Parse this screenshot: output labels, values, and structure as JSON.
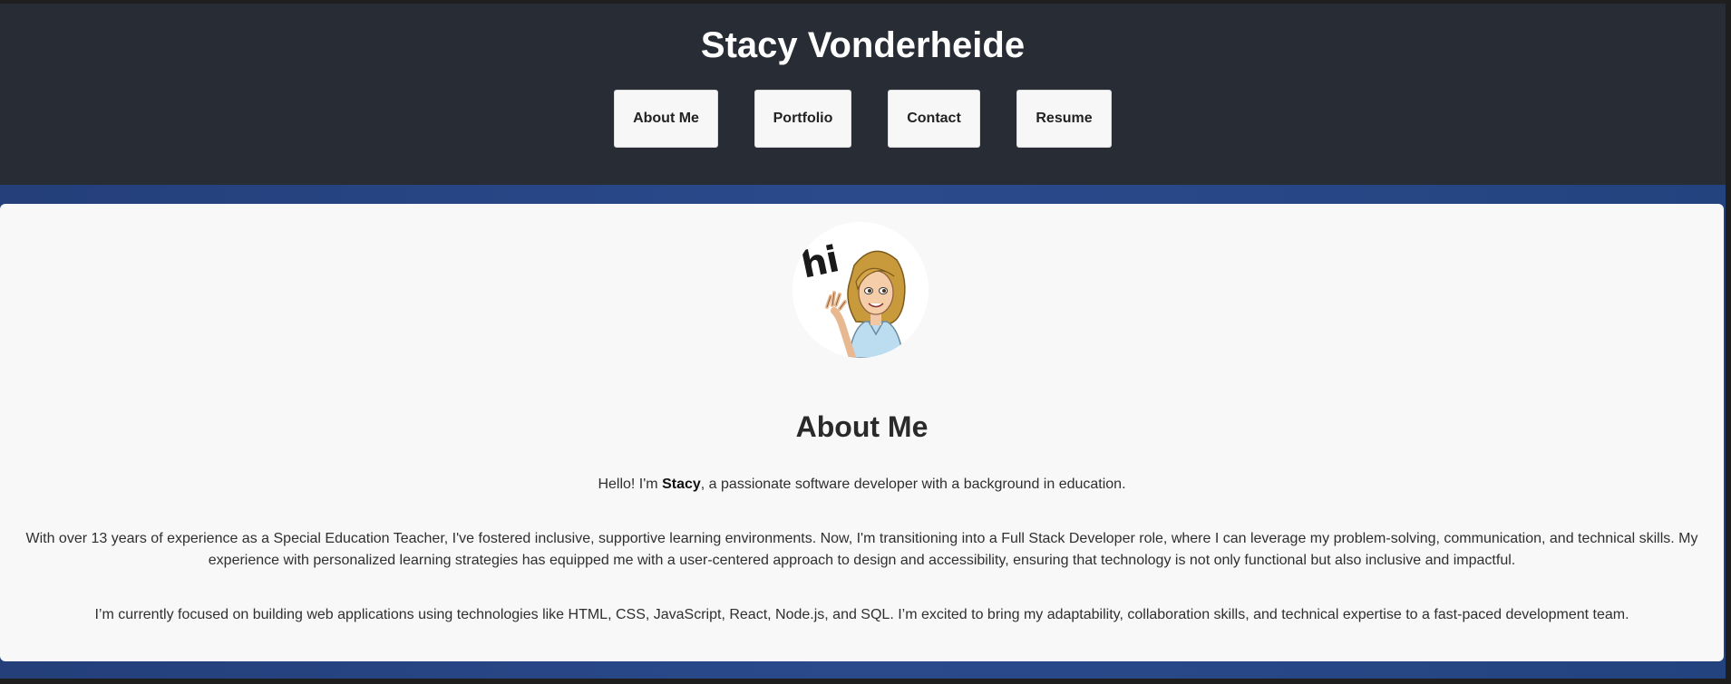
{
  "header": {
    "title": "Stacy Vonderheide",
    "nav": [
      "About Me",
      "Portfolio",
      "Contact",
      "Resume"
    ]
  },
  "avatar": {
    "greeting": "hi"
  },
  "about": {
    "heading": "About Me",
    "intro_prefix": "Hello! I'm ",
    "intro_name": "Stacy",
    "intro_suffix": ", a passionate software developer with a background in education.",
    "paragraph2": "With over 13 years of experience as a Special Education Teacher, I've fostered inclusive, supportive learning environments. Now, I'm transitioning into a Full Stack Developer role, where I can leverage my problem-solving, communication, and technical skills. My experience with personalized learning strategies has equipped me with a user-centered approach to design and accessibility, ensuring that technology is not only functional but also inclusive and impactful.",
    "paragraph3": "I’m currently focused on building web applications using technologies like HTML, CSS, JavaScript, React, Node.js, and SQL. I’m excited to bring my adaptability, collaboration skills, and technical expertise to a fast-paced development team."
  },
  "colors": {
    "header_bg": "#282c34",
    "accent_bg": "#2a4a8c",
    "card_bg": "#f8f8f8"
  }
}
